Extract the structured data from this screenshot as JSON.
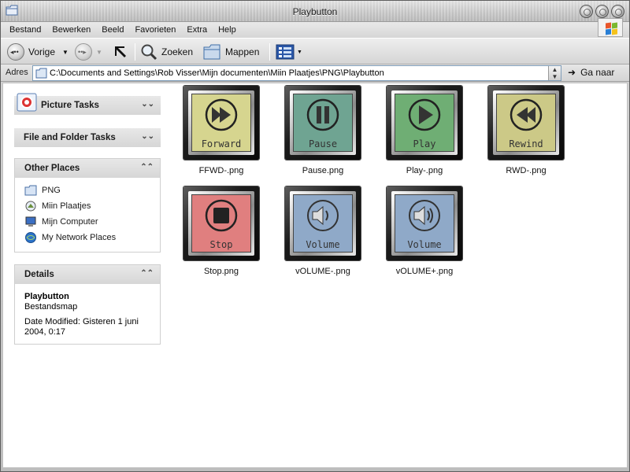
{
  "window": {
    "title": "Playbutton"
  },
  "menu": [
    {
      "label": "Bestand"
    },
    {
      "label": "Bewerken"
    },
    {
      "label": "Beeld"
    },
    {
      "label": "Favorieten"
    },
    {
      "label": "Extra"
    },
    {
      "label": "Help"
    }
  ],
  "toolbar": {
    "back_label": "Vorige",
    "search_label": "Zoeken",
    "folders_label": "Mappen"
  },
  "address": {
    "label": "Adres",
    "path": "C:\\Documents and Settings\\Rob Visser\\Mijn documenten\\Miin Plaatjes\\PNG\\Playbutton",
    "go_label": "Ga naar"
  },
  "panels": {
    "picture_tasks": "Picture Tasks",
    "file_folder_tasks": "File and Folder Tasks",
    "other_places": {
      "title": "Other Places",
      "items": [
        {
          "label": "PNG",
          "icon": "folder-icon"
        },
        {
          "label": "Miin Plaatjes",
          "icon": "pictures-folder-icon"
        },
        {
          "label": "Mijn Computer",
          "icon": "computer-icon"
        },
        {
          "label": "My Network Places",
          "icon": "network-icon"
        }
      ]
    },
    "details": {
      "title": "Details",
      "name": "Playbutton",
      "type": "Bestandsmap",
      "modified": "Date Modified: Gisteren 1 juni 2004, 0:17"
    }
  },
  "files": [
    {
      "name": "FFWD-.png",
      "label": "Forward",
      "color": "#d6d58f",
      "icon": "forward-icon"
    },
    {
      "name": "Pause.png",
      "label": "Pause",
      "color": "#6fa492",
      "icon": "pause-icon"
    },
    {
      "name": "Play-.png",
      "label": "Play",
      "color": "#6fae74",
      "icon": "play-icon"
    },
    {
      "name": "RWD-.png",
      "label": "Rewind",
      "color": "#ccc987",
      "icon": "rewind-icon"
    },
    {
      "name": "Stop.png",
      "label": "Stop",
      "color": "#e07f7f",
      "icon": "stop-icon"
    },
    {
      "name": "vOLUME-.png",
      "label": "Volume",
      "color": "#8fa9c8",
      "icon": "volume-down-icon"
    },
    {
      "name": "vOLUME+.png",
      "label": "Volume",
      "color": "#8fa9c8",
      "icon": "volume-up-icon"
    }
  ]
}
